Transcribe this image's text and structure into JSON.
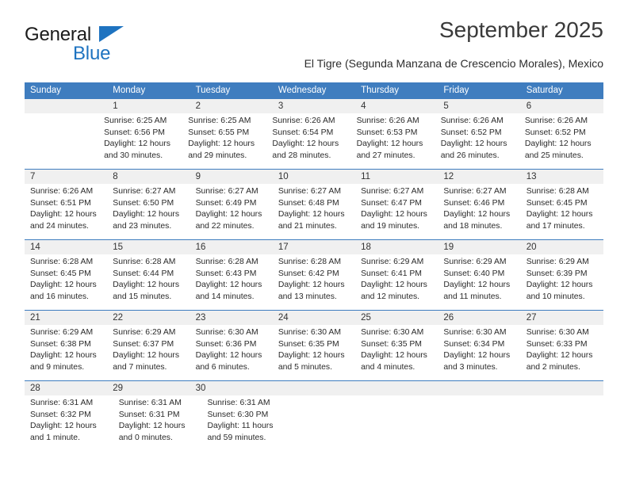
{
  "brand": {
    "name_part1": "General",
    "name_part2": "Blue",
    "triangle_color": "#1e73c0"
  },
  "header": {
    "month_title": "September 2025",
    "location": "El Tigre (Segunda Manzana de Crescencio Morales), Mexico"
  },
  "calendar": {
    "header_bg": "#3f7dbf",
    "weekdays": [
      "Sunday",
      "Monday",
      "Tuesday",
      "Wednesday",
      "Thursday",
      "Friday",
      "Saturday"
    ],
    "weeks": [
      {
        "days": [
          {
            "num": "",
            "lines": []
          },
          {
            "num": "1",
            "lines": [
              "Sunrise: 6:25 AM",
              "Sunset: 6:56 PM",
              "Daylight: 12 hours",
              "and 30 minutes."
            ]
          },
          {
            "num": "2",
            "lines": [
              "Sunrise: 6:25 AM",
              "Sunset: 6:55 PM",
              "Daylight: 12 hours",
              "and 29 minutes."
            ]
          },
          {
            "num": "3",
            "lines": [
              "Sunrise: 6:26 AM",
              "Sunset: 6:54 PM",
              "Daylight: 12 hours",
              "and 28 minutes."
            ]
          },
          {
            "num": "4",
            "lines": [
              "Sunrise: 6:26 AM",
              "Sunset: 6:53 PM",
              "Daylight: 12 hours",
              "and 27 minutes."
            ]
          },
          {
            "num": "5",
            "lines": [
              "Sunrise: 6:26 AM",
              "Sunset: 6:52 PM",
              "Daylight: 12 hours",
              "and 26 minutes."
            ]
          },
          {
            "num": "6",
            "lines": [
              "Sunrise: 6:26 AM",
              "Sunset: 6:52 PM",
              "Daylight: 12 hours",
              "and 25 minutes."
            ]
          }
        ]
      },
      {
        "days": [
          {
            "num": "7",
            "lines": [
              "Sunrise: 6:26 AM",
              "Sunset: 6:51 PM",
              "Daylight: 12 hours",
              "and 24 minutes."
            ]
          },
          {
            "num": "8",
            "lines": [
              "Sunrise: 6:27 AM",
              "Sunset: 6:50 PM",
              "Daylight: 12 hours",
              "and 23 minutes."
            ]
          },
          {
            "num": "9",
            "lines": [
              "Sunrise: 6:27 AM",
              "Sunset: 6:49 PM",
              "Daylight: 12 hours",
              "and 22 minutes."
            ]
          },
          {
            "num": "10",
            "lines": [
              "Sunrise: 6:27 AM",
              "Sunset: 6:48 PM",
              "Daylight: 12 hours",
              "and 21 minutes."
            ]
          },
          {
            "num": "11",
            "lines": [
              "Sunrise: 6:27 AM",
              "Sunset: 6:47 PM",
              "Daylight: 12 hours",
              "and 19 minutes."
            ]
          },
          {
            "num": "12",
            "lines": [
              "Sunrise: 6:27 AM",
              "Sunset: 6:46 PM",
              "Daylight: 12 hours",
              "and 18 minutes."
            ]
          },
          {
            "num": "13",
            "lines": [
              "Sunrise: 6:28 AM",
              "Sunset: 6:45 PM",
              "Daylight: 12 hours",
              "and 17 minutes."
            ]
          }
        ]
      },
      {
        "days": [
          {
            "num": "14",
            "lines": [
              "Sunrise: 6:28 AM",
              "Sunset: 6:45 PM",
              "Daylight: 12 hours",
              "and 16 minutes."
            ]
          },
          {
            "num": "15",
            "lines": [
              "Sunrise: 6:28 AM",
              "Sunset: 6:44 PM",
              "Daylight: 12 hours",
              "and 15 minutes."
            ]
          },
          {
            "num": "16",
            "lines": [
              "Sunrise: 6:28 AM",
              "Sunset: 6:43 PM",
              "Daylight: 12 hours",
              "and 14 minutes."
            ]
          },
          {
            "num": "17",
            "lines": [
              "Sunrise: 6:28 AM",
              "Sunset: 6:42 PM",
              "Daylight: 12 hours",
              "and 13 minutes."
            ]
          },
          {
            "num": "18",
            "lines": [
              "Sunrise: 6:29 AM",
              "Sunset: 6:41 PM",
              "Daylight: 12 hours",
              "and 12 minutes."
            ]
          },
          {
            "num": "19",
            "lines": [
              "Sunrise: 6:29 AM",
              "Sunset: 6:40 PM",
              "Daylight: 12 hours",
              "and 11 minutes."
            ]
          },
          {
            "num": "20",
            "lines": [
              "Sunrise: 6:29 AM",
              "Sunset: 6:39 PM",
              "Daylight: 12 hours",
              "and 10 minutes."
            ]
          }
        ]
      },
      {
        "days": [
          {
            "num": "21",
            "lines": [
              "Sunrise: 6:29 AM",
              "Sunset: 6:38 PM",
              "Daylight: 12 hours",
              "and 9 minutes."
            ]
          },
          {
            "num": "22",
            "lines": [
              "Sunrise: 6:29 AM",
              "Sunset: 6:37 PM",
              "Daylight: 12 hours",
              "and 7 minutes."
            ]
          },
          {
            "num": "23",
            "lines": [
              "Sunrise: 6:30 AM",
              "Sunset: 6:36 PM",
              "Daylight: 12 hours",
              "and 6 minutes."
            ]
          },
          {
            "num": "24",
            "lines": [
              "Sunrise: 6:30 AM",
              "Sunset: 6:35 PM",
              "Daylight: 12 hours",
              "and 5 minutes."
            ]
          },
          {
            "num": "25",
            "lines": [
              "Sunrise: 6:30 AM",
              "Sunset: 6:35 PM",
              "Daylight: 12 hours",
              "and 4 minutes."
            ]
          },
          {
            "num": "26",
            "lines": [
              "Sunrise: 6:30 AM",
              "Sunset: 6:34 PM",
              "Daylight: 12 hours",
              "and 3 minutes."
            ]
          },
          {
            "num": "27",
            "lines": [
              "Sunrise: 6:30 AM",
              "Sunset: 6:33 PM",
              "Daylight: 12 hours",
              "and 2 minutes."
            ]
          }
        ]
      },
      {
        "days": [
          {
            "num": "28",
            "lines": [
              "Sunrise: 6:31 AM",
              "Sunset: 6:32 PM",
              "Daylight: 12 hours",
              "and 1 minute."
            ]
          },
          {
            "num": "29",
            "lines": [
              "Sunrise: 6:31 AM",
              "Sunset: 6:31 PM",
              "Daylight: 12 hours",
              "and 0 minutes."
            ]
          },
          {
            "num": "30",
            "lines": [
              "Sunrise: 6:31 AM",
              "Sunset: 6:30 PM",
              "Daylight: 11 hours",
              "and 59 minutes."
            ]
          },
          {
            "num": "",
            "lines": []
          },
          {
            "num": "",
            "lines": []
          },
          {
            "num": "",
            "lines": []
          },
          {
            "num": "",
            "lines": []
          }
        ]
      }
    ]
  }
}
